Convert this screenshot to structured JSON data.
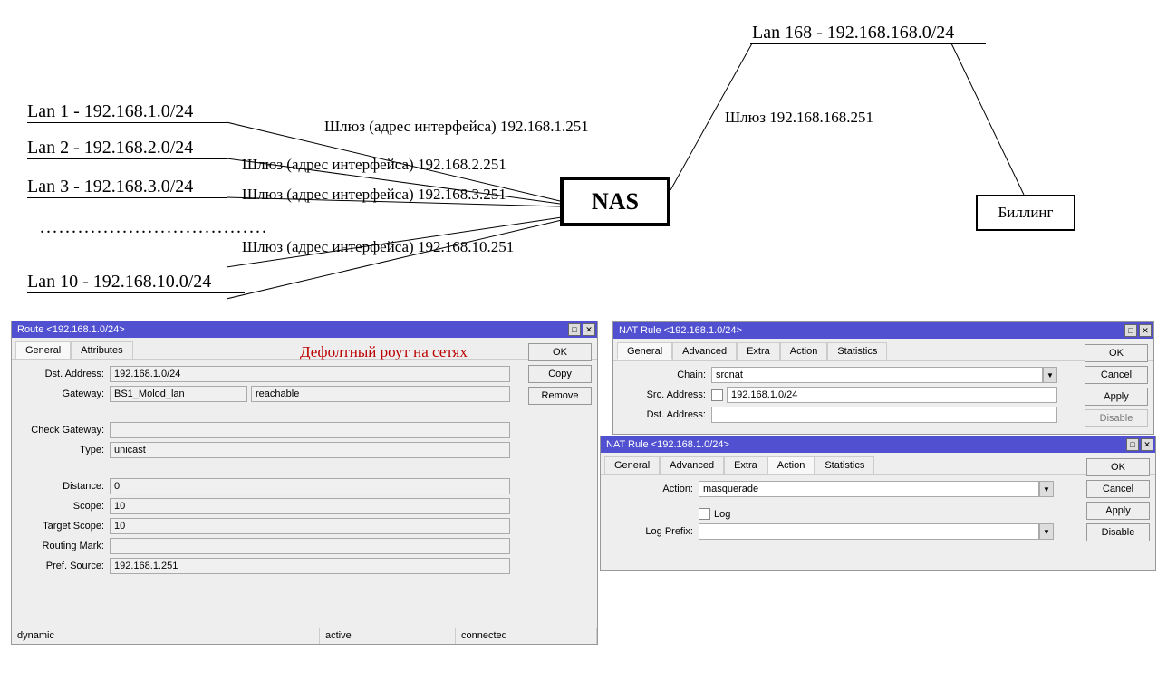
{
  "diagram": {
    "lan1": "Lan 1 - 192.168.1.0/24",
    "lan2": "Lan 2 - 192.168.2.0/24",
    "lan3": "Lan 3 - 192.168.3.0/24",
    "lan10": "Lan 10 - 192.168.10.0/24",
    "lan168": "Lan 168 - 192.168.168.0/24",
    "gw1": "Шлюз (адрес интерфейса) 192.168.1.251",
    "gw2": "Шлюз (адрес интерфейса) 192.168.2.251",
    "gw3": "Шлюз (адрес интерфейса) 192.168.3.251",
    "gw10": "Шлюз (адрес интерфейса) 192.168.10.251",
    "gw168": "Шлюз 192.168.168.251",
    "nas": "NAS",
    "billing": "Биллинг",
    "dots": "...................................."
  },
  "route_window": {
    "title": "Route <192.168.1.0/24>",
    "heading": "Дефолтный роут на сетях",
    "tabs": {
      "general": "General",
      "attributes": "Attributes"
    },
    "labels": {
      "dst_address": "Dst. Address:",
      "gateway": "Gateway:",
      "check_gateway": "Check Gateway:",
      "type": "Type:",
      "distance": "Distance:",
      "scope": "Scope:",
      "target_scope": "Target Scope:",
      "routing_mark": "Routing Mark:",
      "pref_source": "Pref. Source:"
    },
    "values": {
      "dst_address": "192.168.1.0/24",
      "gateway": "BS1_Molod_lan",
      "gateway_status": "reachable",
      "check_gateway": "",
      "type": "unicast",
      "distance": "0",
      "scope": "10",
      "target_scope": "10",
      "routing_mark": "",
      "pref_source": "192.168.1.251"
    },
    "buttons": {
      "ok": "OK",
      "copy": "Copy",
      "remove": "Remove"
    },
    "status": {
      "dynamic": "dynamic",
      "active": "active",
      "connected": "connected"
    }
  },
  "nat1": {
    "title": "NAT Rule <192.168.1.0/24>",
    "tabs": {
      "general": "General",
      "advanced": "Advanced",
      "extra": "Extra",
      "action": "Action",
      "statistics": "Statistics"
    },
    "labels": {
      "chain": "Chain:",
      "src_address": "Src. Address:",
      "dst_address": "Dst. Address:"
    },
    "values": {
      "chain": "srcnat",
      "src_address": "192.168.1.0/24",
      "dst_address": ""
    },
    "buttons": {
      "ok": "OK",
      "cancel": "Cancel",
      "apply": "Apply",
      "disable": "Disable"
    }
  },
  "nat2": {
    "title": "NAT Rule <192.168.1.0/24>",
    "tabs": {
      "general": "General",
      "advanced": "Advanced",
      "extra": "Extra",
      "action": "Action",
      "statistics": "Statistics"
    },
    "labels": {
      "action": "Action:",
      "log": "Log",
      "log_prefix": "Log Prefix:"
    },
    "values": {
      "action": "masquerade",
      "log_prefix": ""
    },
    "buttons": {
      "ok": "OK",
      "cancel": "Cancel",
      "apply": "Apply",
      "disable": "Disable"
    }
  }
}
